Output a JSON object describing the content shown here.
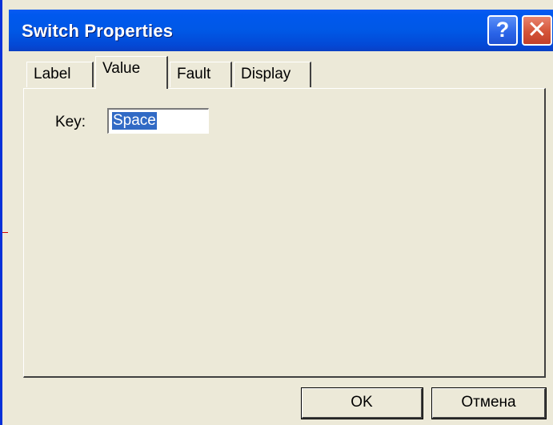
{
  "window": {
    "title": "Switch Properties",
    "help_glyph": "?",
    "close_glyph": "✕",
    "accent_color": "#0058e6",
    "background_color": "#ece9d8"
  },
  "tabs": [
    {
      "label": "Label",
      "active": false
    },
    {
      "label": "Value",
      "active": true
    },
    {
      "label": "Fault",
      "active": false
    },
    {
      "label": "Display",
      "active": false
    }
  ],
  "value_tab": {
    "key_label": "Key:",
    "key_value": "Space"
  },
  "buttons": {
    "ok_label": "OK",
    "cancel_label": "Отмена"
  }
}
